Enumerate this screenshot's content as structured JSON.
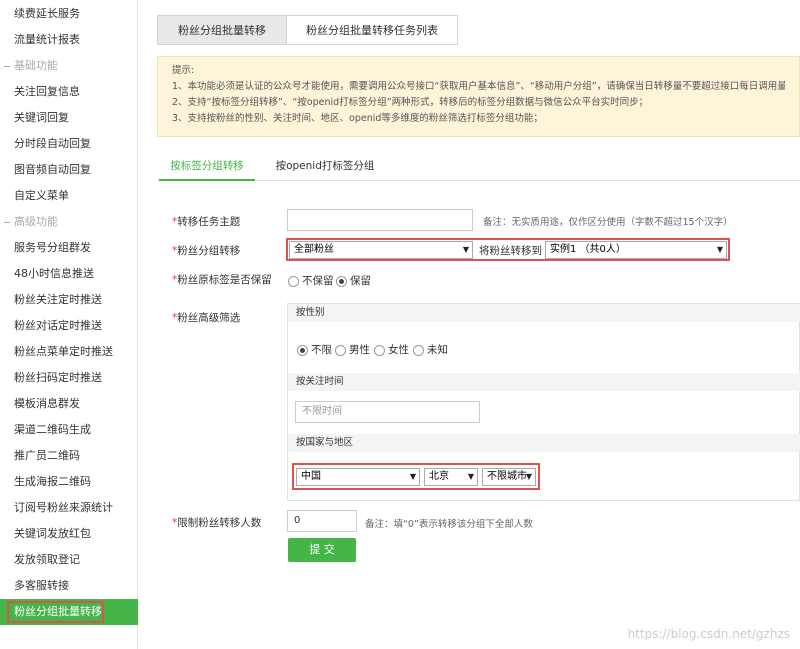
{
  "sidebar": {
    "items": [
      {
        "label": "续费延长服务",
        "kind": "item"
      },
      {
        "label": "流量统计报表",
        "kind": "item"
      },
      {
        "label": "基础功能",
        "kind": "section"
      },
      {
        "label": "关注回复信息",
        "kind": "item"
      },
      {
        "label": "关键词回复",
        "kind": "item"
      },
      {
        "label": "分时段自动回复",
        "kind": "item"
      },
      {
        "label": "图音频自动回复",
        "kind": "item"
      },
      {
        "label": "自定义菜单",
        "kind": "item"
      },
      {
        "label": "高级功能",
        "kind": "section"
      },
      {
        "label": "服务号分组群发",
        "kind": "item"
      },
      {
        "label": "48小时信息推送",
        "kind": "item"
      },
      {
        "label": "粉丝关注定时推送",
        "kind": "item"
      },
      {
        "label": "粉丝对话定时推送",
        "kind": "item"
      },
      {
        "label": "粉丝点菜单定时推送",
        "kind": "item"
      },
      {
        "label": "粉丝扫码定时推送",
        "kind": "item"
      },
      {
        "label": "模板消息群发",
        "kind": "item"
      },
      {
        "label": "渠道二维码生成",
        "kind": "item"
      },
      {
        "label": "推广员二维码",
        "kind": "item"
      },
      {
        "label": "生成海报二维码",
        "kind": "item"
      },
      {
        "label": "订阅号粉丝来源统计",
        "kind": "item"
      },
      {
        "label": "关键词发放红包",
        "kind": "item"
      },
      {
        "label": "发放领取登记",
        "kind": "item"
      },
      {
        "label": "多客服转接",
        "kind": "item"
      },
      {
        "label": "粉丝分组批量转移",
        "kind": "item",
        "active": true
      }
    ]
  },
  "top_tabs": [
    {
      "label": "粉丝分组批量转移",
      "active": true
    },
    {
      "label": "粉丝分组批量转移任务列表",
      "active": false
    }
  ],
  "notice": {
    "title": "提示:",
    "lines": [
      "1、本功能必须是认证的公众号才能使用，需要调用公众号接口“获取用户基本信息”、“移动用户分组”，请确保当日转移量不要超过接口每日调用量的上限；",
      "2、支持“按标签分组转移”、“按openid打标签分组”两种形式，转移后的标签分组数据与微信公众平台实时同步；",
      "3、支持按粉丝的性别、关注时间、地区、openid等多维度的粉丝筛选打标签分组功能；"
    ]
  },
  "sub_tabs": [
    {
      "label": "按标签分组转移",
      "active": true
    },
    {
      "label": "按openid打标签分组",
      "active": false
    }
  ],
  "form": {
    "task_subject": {
      "label": "转移任务主题",
      "value": "",
      "hint": "备注：无实质用途，仅作区分使用（字数不超过15个汉字）"
    },
    "group_transfer": {
      "label": "粉丝分组转移",
      "source": "全部粉丝",
      "to_label": "将粉丝转移到",
      "target": "实例1 （共0人）"
    },
    "keep_tag": {
      "label": "粉丝原标签是否保留",
      "options": [
        "不保留",
        "保留"
      ],
      "selected": 1
    },
    "advanced": {
      "label": "粉丝高级筛选",
      "gender_head": "按性别",
      "gender_options": [
        "不限",
        "男性",
        "女性",
        "未知"
      ],
      "gender_selected": 0,
      "time_head": "按关注时间",
      "time_placeholder": "不限时间",
      "region_head": "按国家与地区",
      "country": "中国",
      "province": "北京",
      "city": "不限城市"
    },
    "limit": {
      "label": "限制粉丝转移人数",
      "value": "0",
      "hint": "备注：填“0”表示转移该分组下全部人数"
    },
    "submit_label": "提 交"
  },
  "watermark": "https://blog.csdn.net/gzhzs",
  "colors": {
    "accent": "#44b549",
    "highlight": "#d9534f",
    "notice_bg": "#fdf4d9"
  }
}
